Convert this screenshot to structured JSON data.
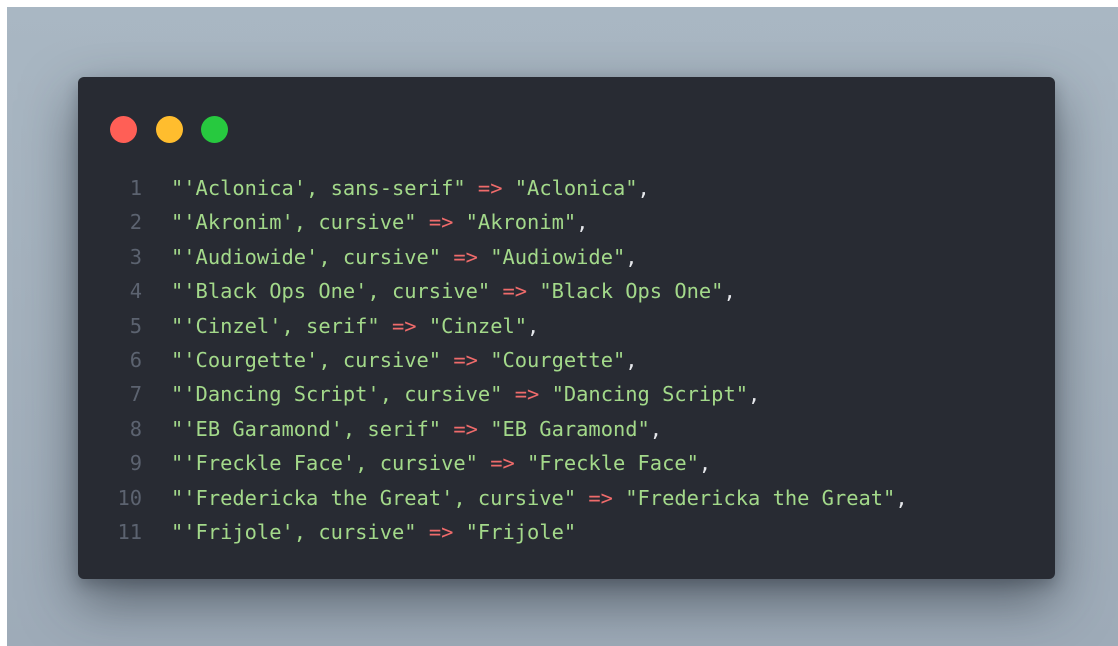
{
  "window": {
    "buttons": [
      {
        "name": "close",
        "color": "#ff5f56"
      },
      {
        "name": "minimize",
        "color": "#ffbd2e"
      },
      {
        "name": "maximize",
        "color": "#27c93f"
      }
    ]
  },
  "theme": {
    "string_color": "#a3d98a",
    "operator_color": "#ef6b6b",
    "line_number_color": "#5c6370",
    "background": "#282b33"
  },
  "code_lines": [
    {
      "number": "1",
      "left": "\"'Aclonica', sans-serif\"",
      "op": "=>",
      "right": "\"Aclonica\"",
      "tail": ","
    },
    {
      "number": "2",
      "left": "\"'Akronim', cursive\"",
      "op": "=>",
      "right": "\"Akronim\"",
      "tail": ","
    },
    {
      "number": "3",
      "left": "\"'Audiowide', cursive\"",
      "op": "=>",
      "right": "\"Audiowide\"",
      "tail": ","
    },
    {
      "number": "4",
      "left": "\"'Black Ops One', cursive\"",
      "op": "=>",
      "right": "\"Black Ops One\"",
      "tail": ","
    },
    {
      "number": "5",
      "left": "\"'Cinzel', serif\"",
      "op": "=>",
      "right": "\"Cinzel\"",
      "tail": ","
    },
    {
      "number": "6",
      "left": "\"'Courgette', cursive\"",
      "op": "=>",
      "right": "\"Courgette\"",
      "tail": ","
    },
    {
      "number": "7",
      "left": "\"'Dancing Script', cursive\"",
      "op": "=>",
      "right": "\"Dancing Script\"",
      "tail": ","
    },
    {
      "number": "8",
      "left": "\"'EB Garamond', serif\"",
      "op": "=>",
      "right": "\"EB Garamond\"",
      "tail": ","
    },
    {
      "number": "9",
      "left": "\"'Freckle Face', cursive\"",
      "op": "=>",
      "right": "\"Freckle Face\"",
      "tail": ","
    },
    {
      "number": "10",
      "left": "\"'Fredericka the Great', cursive\"",
      "op": "=>",
      "right": "\"Fredericka the Great\"",
      "tail": ","
    },
    {
      "number": "11",
      "left": "\"'Frijole', cursive\"",
      "op": "=>",
      "right": "\"Frijole\"",
      "tail": ""
    }
  ]
}
